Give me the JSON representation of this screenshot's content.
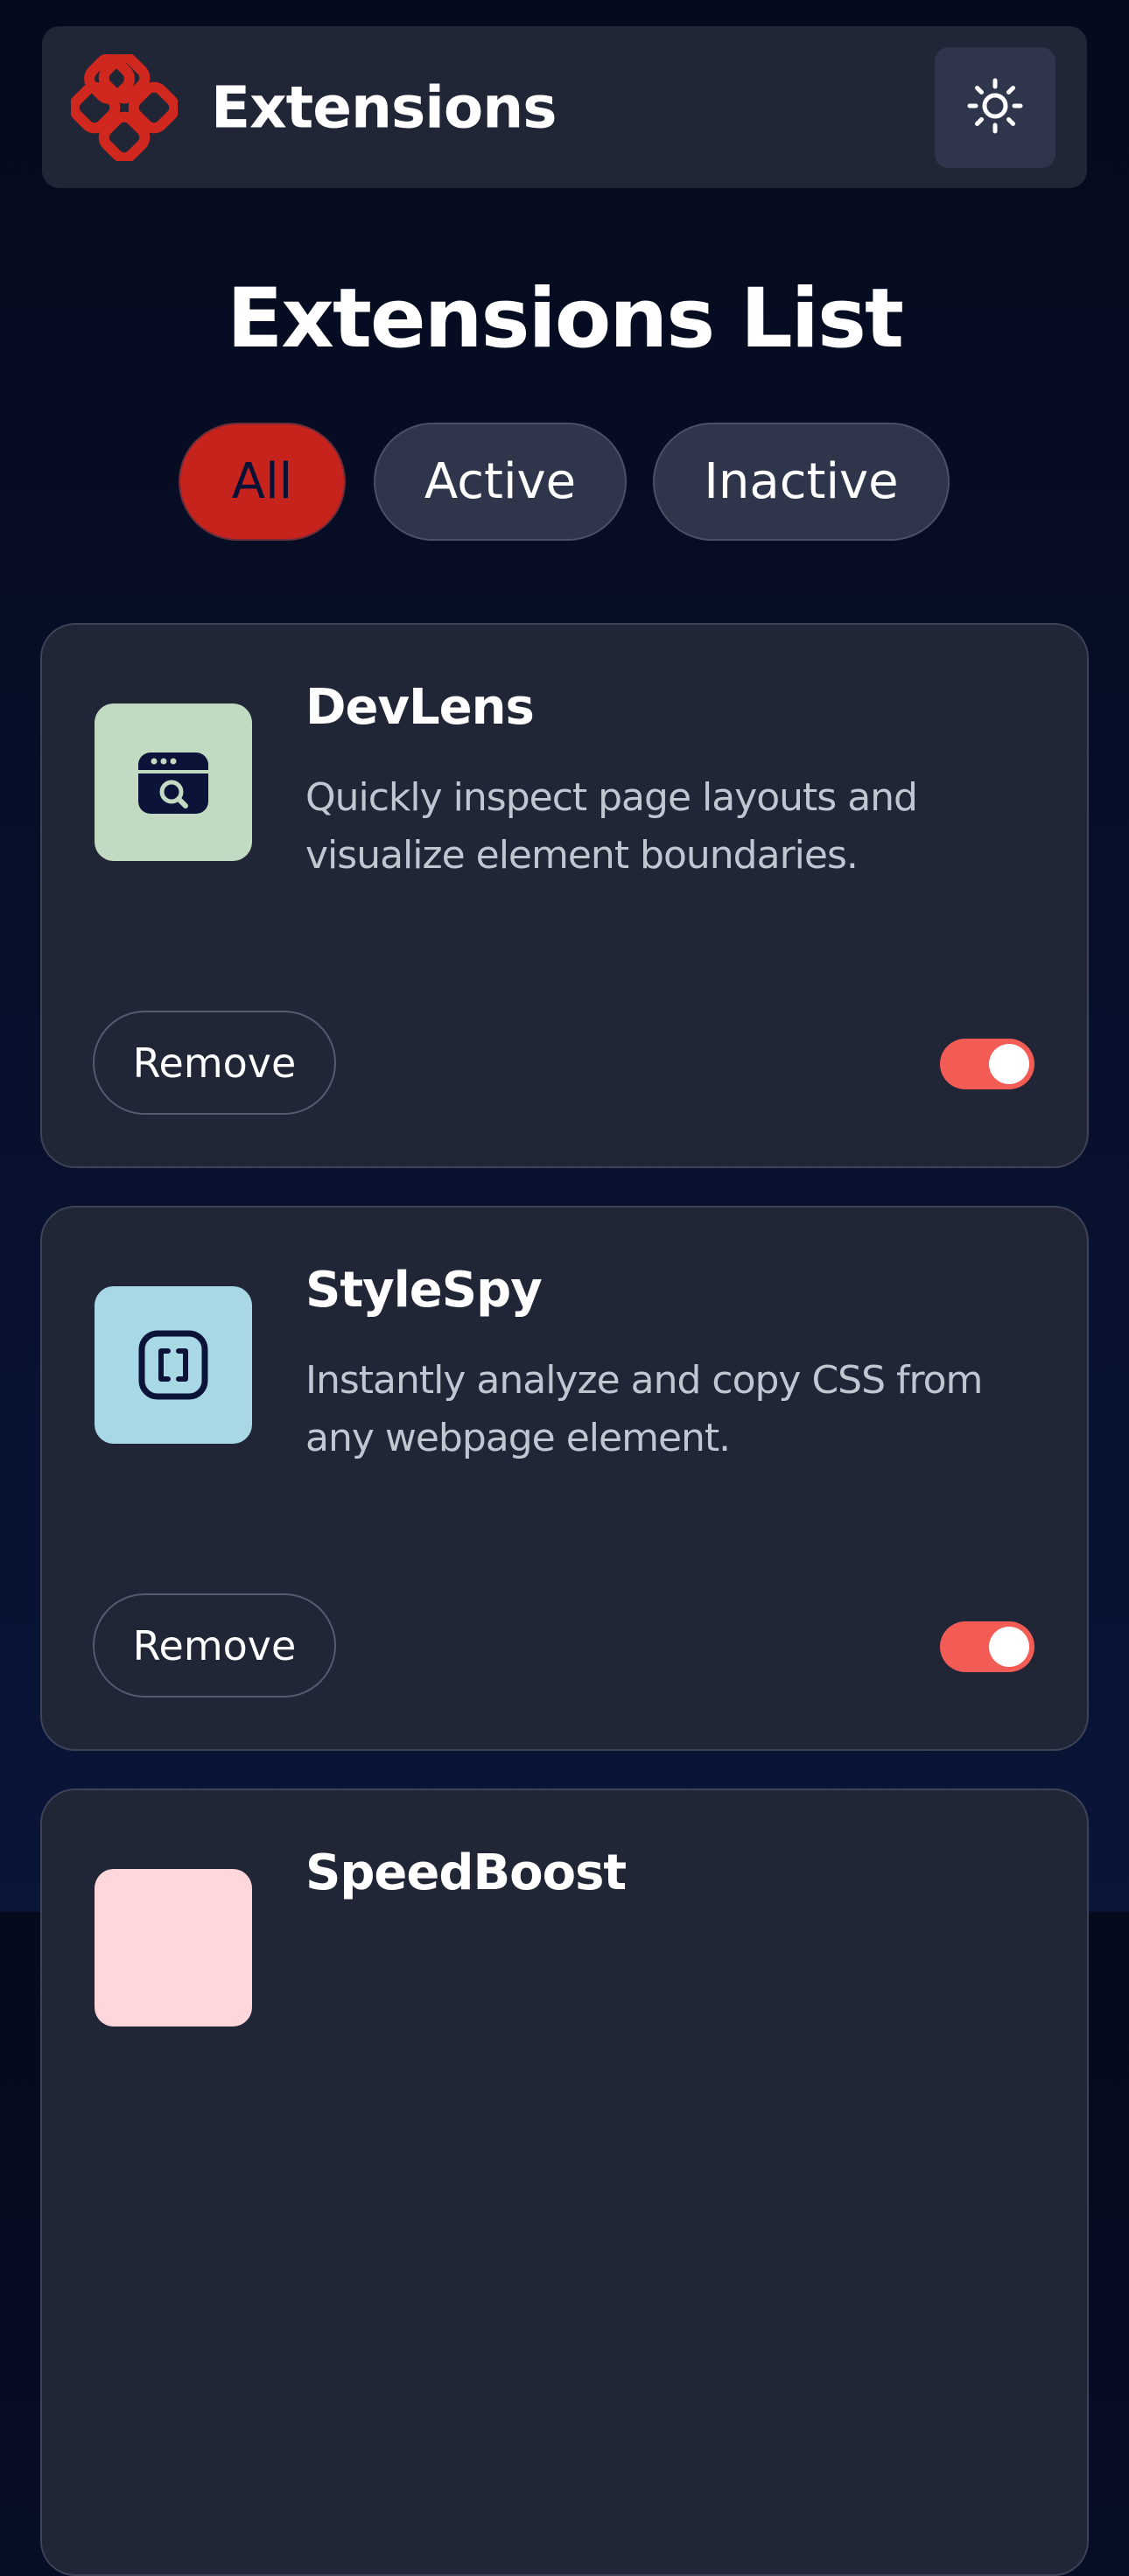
{
  "header": {
    "app_name": "Extensions",
    "logo_icon": "logo-icon",
    "theme_toggle_icon": "sun-icon"
  },
  "page_title": "Extensions List",
  "filters": [
    {
      "label": "All",
      "selected": true
    },
    {
      "label": "Active",
      "selected": false
    },
    {
      "label": "Inactive",
      "selected": false
    }
  ],
  "extensions": [
    {
      "name": "DevLens",
      "description": "Quickly inspect page layouts and visualize element boundaries.",
      "icon": "devlens-icon",
      "icon_bg": "#c2d9c2",
      "remove_label": "Remove",
      "enabled": true
    },
    {
      "name": "StyleSpy",
      "description": "Instantly analyze and copy CSS from any webpage element.",
      "icon": "stylespy-icon",
      "icon_bg": "#a8d7e6",
      "remove_label": "Remove",
      "enabled": true
    },
    {
      "name": "SpeedBoost",
      "icon": "speedboost-icon",
      "icon_bg": "#ffd6d9"
    }
  ],
  "colors": {
    "accent": "#c7231d",
    "toggle_on": "#f25c54",
    "card_bg": "#212636",
    "page_bg": "#050a1c"
  }
}
